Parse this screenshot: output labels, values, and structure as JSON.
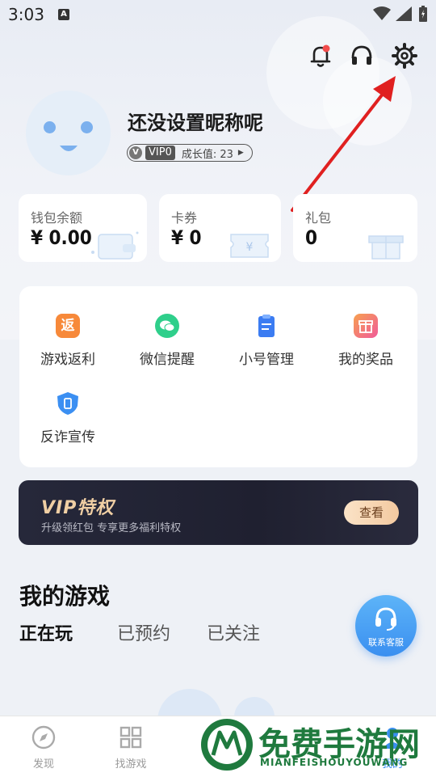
{
  "status_bar": {
    "time": "3:03",
    "notif_glyph": "A"
  },
  "profile": {
    "nickname": "还没设置昵称呢",
    "vip_prefix": "V",
    "vip_level": "VIP0",
    "growth_label": "成长值: 23"
  },
  "wallet": [
    {
      "label": "钱包余额",
      "value": "¥ 0.00"
    },
    {
      "label": "卡券",
      "value": "¥ 0"
    },
    {
      "label": "礼包",
      "value": "0"
    }
  ],
  "functions": [
    {
      "label": "游戏返利",
      "icon": "rebate-icon",
      "glyph": "返",
      "color": "#f7893a"
    },
    {
      "label": "微信提醒",
      "icon": "wechat-icon",
      "color": "#2fcf8b"
    },
    {
      "label": "小号管理",
      "icon": "clipboard-icon",
      "color": "#3b7cf2"
    },
    {
      "label": "我的奖品",
      "icon": "gift-icon",
      "color": "#f56b8a"
    },
    {
      "label": "反诈宣传",
      "icon": "shield-phone-icon",
      "color": "#3b8ff2"
    }
  ],
  "vip_banner": {
    "title": "VIP特权",
    "subtitle": "升级领红包 专享更多福利特权",
    "button": "查看"
  },
  "my_games": {
    "title": "我的游戏",
    "tabs": [
      "正在玩",
      "已预约",
      "已关注"
    ],
    "active_tab": 0
  },
  "customer_service": {
    "label": "联系客服"
  },
  "bottom_nav": [
    {
      "label": "发现",
      "icon": "compass-icon"
    },
    {
      "label": "找游戏",
      "icon": "grid-icon"
    },
    {
      "label": "我的",
      "icon": "user-icon"
    }
  ],
  "watermark": {
    "main": "免费手游网",
    "sub": "MIANFEISHOUYOUWANG"
  },
  "colors": {
    "accent": "#3a8ff0",
    "vip_gold": "#f0cfa4",
    "annotation_arrow": "#e02020"
  }
}
